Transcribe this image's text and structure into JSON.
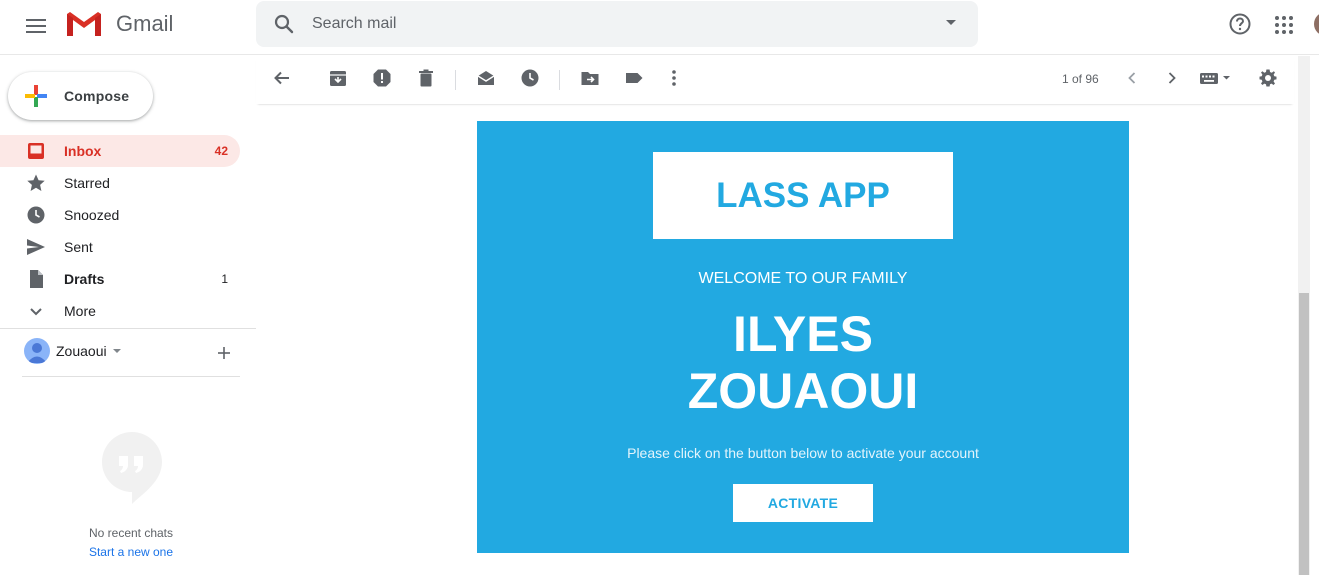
{
  "app": {
    "logo_text": "Gmail"
  },
  "search": {
    "placeholder": "Search mail"
  },
  "compose": {
    "label": "Compose"
  },
  "sidebar": {
    "items": [
      {
        "label": "Inbox",
        "count": "42",
        "icon": "inbox-icon",
        "active": true
      },
      {
        "label": "Starred",
        "count": "",
        "icon": "star-icon"
      },
      {
        "label": "Snoozed",
        "count": "",
        "icon": "clock-icon"
      },
      {
        "label": "Sent",
        "count": "",
        "icon": "send-icon"
      },
      {
        "label": "Drafts",
        "count": "1",
        "icon": "draft-icon"
      },
      {
        "label": "More",
        "count": "",
        "icon": "chevron-down-icon"
      }
    ]
  },
  "hangouts": {
    "user_name": "Zouaoui",
    "empty_text": "No recent chats",
    "start_link": "Start a new one"
  },
  "toolbar": {
    "pager": "1 of 96"
  },
  "email": {
    "brand": "LASS APP",
    "welcome": "WELCOME TO OUR FAMILY",
    "name_line1": "ILYES",
    "name_line2": "ZOUAOUI",
    "instruction": "Please click on the button below to activate your account",
    "button": "ACTIVATE"
  },
  "colors": {
    "email_bg": "#22a9e1",
    "inbox_active_bg": "#fce8e6",
    "inbox_active_text": "#d93025"
  }
}
